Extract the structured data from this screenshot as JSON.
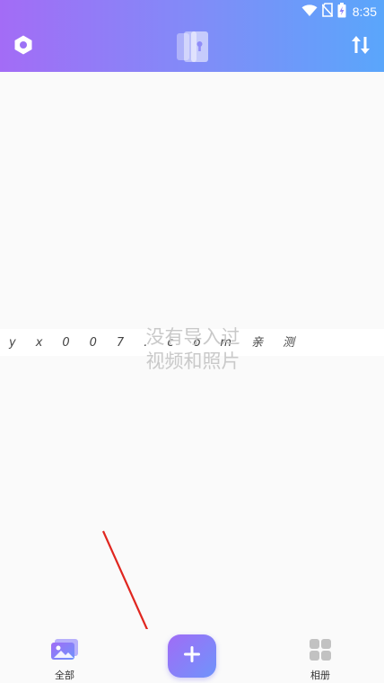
{
  "status_bar": {
    "time": "8:35",
    "wifi_icon": "wifi-icon",
    "sim_icon": "no-sim-icon",
    "battery_icon": "battery-charging-icon"
  },
  "header": {
    "settings_icon": "hexagon-settings-icon",
    "logo_icon": "vault-lock-icon",
    "sort_icon": "sort-arrows-icon",
    "gradient_start": "#a36cf6",
    "gradient_end": "#5aa6fb"
  },
  "watermark": {
    "text": "yx007.com亲测"
  },
  "empty_state": {
    "message": "没有导入过\n视频和照片"
  },
  "annotation": {
    "arrow_color": "#e0261f"
  },
  "bottom_nav": {
    "all_label": "全部",
    "albums_label": "相册",
    "add_icon": "plus-icon",
    "accent": "#8a7ff8"
  }
}
